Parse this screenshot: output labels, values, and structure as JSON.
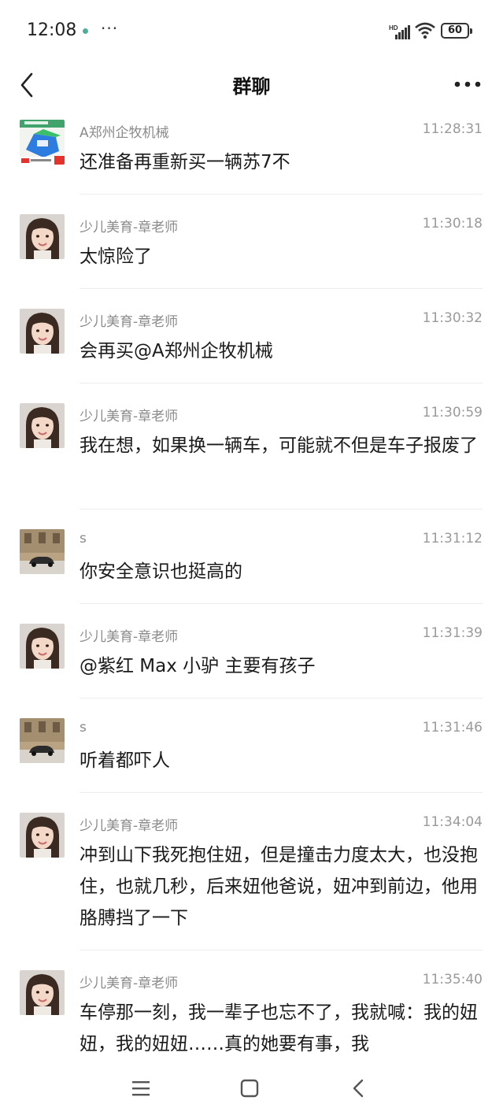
{
  "status": {
    "time": "12:08",
    "more": "···",
    "battery": "60",
    "signal_label": "HD"
  },
  "header": {
    "title": "群聊"
  },
  "messages": [
    {
      "sender": "A郑州企牧机械",
      "time": "11:28:31",
      "text": "还准备再重新买一辆苏7不",
      "avatar": "product-ad"
    },
    {
      "sender": "少儿美育-章老师",
      "time": "11:30:18",
      "text": "太惊险了",
      "avatar": "woman-portrait"
    },
    {
      "sender": "少儿美育-章老师",
      "time": "11:30:32",
      "text": "会再买@A郑州企牧机械",
      "avatar": "woman-portrait"
    },
    {
      "sender": "少儿美育-章老师",
      "time": "11:30:59",
      "text": "我在想，如果换一辆车，可能就不但是车子报废了",
      "avatar": "woman-portrait"
    },
    {
      "sender": "s",
      "time": "11:31:12",
      "text": "你安全意识也挺高的",
      "avatar": "street-car"
    },
    {
      "sender": "少儿美育-章老师",
      "time": "11:31:39",
      "text": "@紫红 Max 小驴 主要有孩子",
      "avatar": "woman-portrait"
    },
    {
      "sender": "s",
      "time": "11:31:46",
      "text": "听着都吓人",
      "avatar": "street-car"
    },
    {
      "sender": "少儿美育-章老师",
      "time": "11:34:04",
      "text": "冲到山下我死抱住妞，但是撞击力度太大，也没抱住，也就几秒，后来妞他爸说，妞冲到前边，他用胳膊挡了一下",
      "avatar": "woman-portrait"
    },
    {
      "sender": "少儿美育-章老师",
      "time": "11:35:40",
      "text": "车停那一刻，我一辈子也忘不了，我就喊：我的妞妞，我的妞妞……真的她要有事，我",
      "avatar": "woman-portrait"
    }
  ],
  "colors": {
    "background": "#ffffff",
    "name": "#8a8a8a",
    "time": "#9a9a9a",
    "text": "#1a1a1a",
    "divider": "#ececec"
  },
  "icons": [
    "back-arrow-icon",
    "more-dots-icon",
    "signal-icon",
    "wifi-icon",
    "battery-icon",
    "nav-menu-icon",
    "nav-home-icon",
    "nav-back-icon"
  ]
}
